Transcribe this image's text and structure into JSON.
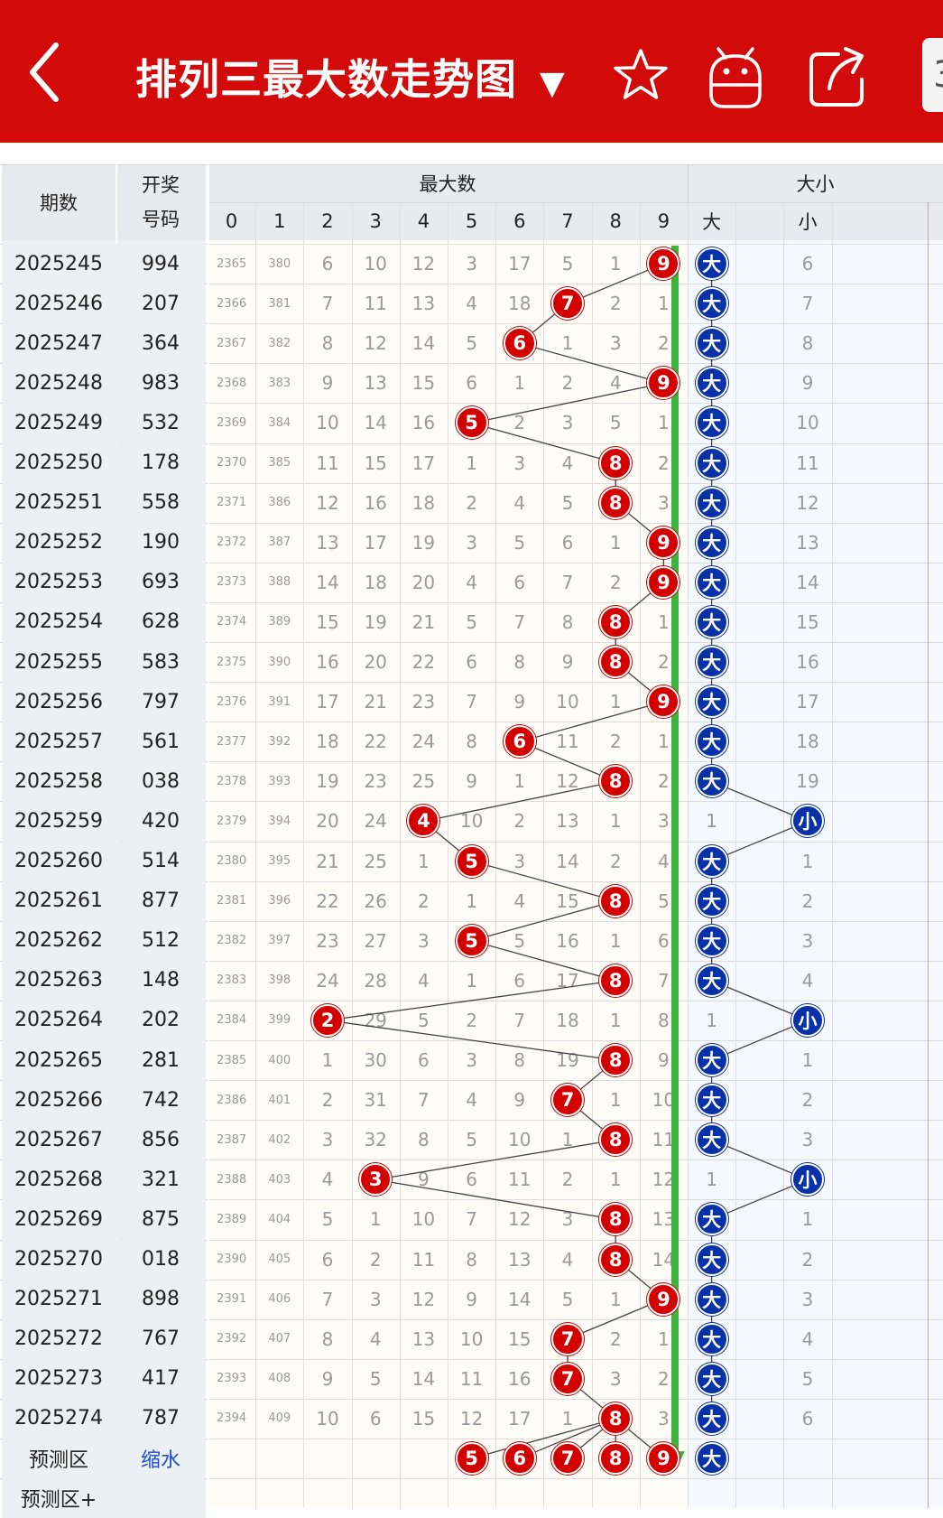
{
  "header": {
    "title": "排列三最大数走势图",
    "menu_caret": "▼",
    "tab_stub_text": "3"
  },
  "table": {
    "headers": {
      "issue": "期数",
      "code_line1": "开奖",
      "code_line2": "号码",
      "max_group": "最大数",
      "size_group": "大小",
      "digits": [
        "0",
        "1",
        "2",
        "3",
        "4",
        "5",
        "6",
        "7",
        "8",
        "9"
      ],
      "size_big": "大",
      "size_small": "小"
    },
    "rows": [
      {
        "issue": "2025245",
        "code": "994",
        "max": 9,
        "miss": [
          "2365",
          "380",
          "6",
          "10",
          "12",
          "3",
          "17",
          "5",
          "1",
          "9"
        ],
        "size": "大",
        "other": "6"
      },
      {
        "issue": "2025246",
        "code": "207",
        "max": 7,
        "miss": [
          "2366",
          "381",
          "7",
          "11",
          "13",
          "4",
          "18",
          "7",
          "2",
          "1"
        ],
        "size": "大",
        "other": "7"
      },
      {
        "issue": "2025247",
        "code": "364",
        "max": 6,
        "miss": [
          "2367",
          "382",
          "8",
          "12",
          "14",
          "5",
          "6",
          "1",
          "3",
          "2"
        ],
        "size": "大",
        "other": "8"
      },
      {
        "issue": "2025248",
        "code": "983",
        "max": 9,
        "miss": [
          "2368",
          "383",
          "9",
          "13",
          "15",
          "6",
          "1",
          "2",
          "4",
          "9"
        ],
        "size": "大",
        "other": "9"
      },
      {
        "issue": "2025249",
        "code": "532",
        "max": 5,
        "miss": [
          "2369",
          "384",
          "10",
          "14",
          "16",
          "5",
          "2",
          "3",
          "5",
          "1"
        ],
        "size": "大",
        "other": "10"
      },
      {
        "issue": "2025250",
        "code": "178",
        "max": 8,
        "miss": [
          "2370",
          "385",
          "11",
          "15",
          "17",
          "1",
          "3",
          "4",
          "8",
          "2"
        ],
        "size": "大",
        "other": "11"
      },
      {
        "issue": "2025251",
        "code": "558",
        "max": 8,
        "miss": [
          "2371",
          "386",
          "12",
          "16",
          "18",
          "2",
          "4",
          "5",
          "8",
          "3"
        ],
        "size": "大",
        "other": "12"
      },
      {
        "issue": "2025252",
        "code": "190",
        "max": 9,
        "miss": [
          "2372",
          "387",
          "13",
          "17",
          "19",
          "3",
          "5",
          "6",
          "1",
          "9"
        ],
        "size": "大",
        "other": "13"
      },
      {
        "issue": "2025253",
        "code": "693",
        "max": 9,
        "miss": [
          "2373",
          "388",
          "14",
          "18",
          "20",
          "4",
          "6",
          "7",
          "2",
          "9"
        ],
        "size": "大",
        "other": "14"
      },
      {
        "issue": "2025254",
        "code": "628",
        "max": 8,
        "miss": [
          "2374",
          "389",
          "15",
          "19",
          "21",
          "5",
          "7",
          "8",
          "8",
          "1"
        ],
        "size": "大",
        "other": "15"
      },
      {
        "issue": "2025255",
        "code": "583",
        "max": 8,
        "miss": [
          "2375",
          "390",
          "16",
          "20",
          "22",
          "6",
          "8",
          "9",
          "8",
          "2"
        ],
        "size": "大",
        "other": "16"
      },
      {
        "issue": "2025256",
        "code": "797",
        "max": 9,
        "miss": [
          "2376",
          "391",
          "17",
          "21",
          "23",
          "7",
          "9",
          "10",
          "1",
          "9"
        ],
        "size": "大",
        "other": "17"
      },
      {
        "issue": "2025257",
        "code": "561",
        "max": 6,
        "miss": [
          "2377",
          "392",
          "18",
          "22",
          "24",
          "8",
          "6",
          "11",
          "2",
          "1"
        ],
        "size": "大",
        "other": "18"
      },
      {
        "issue": "2025258",
        "code": "038",
        "max": 8,
        "miss": [
          "2378",
          "393",
          "19",
          "23",
          "25",
          "9",
          "1",
          "12",
          "8",
          "2"
        ],
        "size": "大",
        "other": "19"
      },
      {
        "issue": "2025259",
        "code": "420",
        "max": 4,
        "miss": [
          "2379",
          "394",
          "20",
          "24",
          "4",
          "10",
          "2",
          "13",
          "1",
          "3"
        ],
        "size": "小",
        "other": "1"
      },
      {
        "issue": "2025260",
        "code": "514",
        "max": 5,
        "miss": [
          "2380",
          "395",
          "21",
          "25",
          "1",
          "5",
          "3",
          "14",
          "2",
          "4"
        ],
        "size": "大",
        "other": "1"
      },
      {
        "issue": "2025261",
        "code": "877",
        "max": 8,
        "miss": [
          "2381",
          "396",
          "22",
          "26",
          "2",
          "1",
          "4",
          "15",
          "8",
          "5"
        ],
        "size": "大",
        "other": "2"
      },
      {
        "issue": "2025262",
        "code": "512",
        "max": 5,
        "miss": [
          "2382",
          "397",
          "23",
          "27",
          "3",
          "5",
          "5",
          "16",
          "1",
          "6"
        ],
        "size": "大",
        "other": "3"
      },
      {
        "issue": "2025263",
        "code": "148",
        "max": 8,
        "miss": [
          "2383",
          "398",
          "24",
          "28",
          "4",
          "1",
          "6",
          "17",
          "8",
          "7"
        ],
        "size": "大",
        "other": "4"
      },
      {
        "issue": "2025264",
        "code": "202",
        "max": 2,
        "miss": [
          "2384",
          "399",
          "2",
          "29",
          "5",
          "2",
          "7",
          "18",
          "1",
          "8"
        ],
        "size": "小",
        "other": "1"
      },
      {
        "issue": "2025265",
        "code": "281",
        "max": 8,
        "miss": [
          "2385",
          "400",
          "1",
          "30",
          "6",
          "3",
          "8",
          "19",
          "8",
          "9"
        ],
        "size": "大",
        "other": "1"
      },
      {
        "issue": "2025266",
        "code": "742",
        "max": 7,
        "miss": [
          "2386",
          "401",
          "2",
          "31",
          "7",
          "4",
          "9",
          "7",
          "1",
          "10"
        ],
        "size": "大",
        "other": "2"
      },
      {
        "issue": "2025267",
        "code": "856",
        "max": 8,
        "miss": [
          "2387",
          "402",
          "3",
          "32",
          "8",
          "5",
          "10",
          "1",
          "8",
          "11"
        ],
        "size": "大",
        "other": "3"
      },
      {
        "issue": "2025268",
        "code": "321",
        "max": 3,
        "miss": [
          "2388",
          "403",
          "4",
          "3",
          "9",
          "6",
          "11",
          "2",
          "1",
          "12"
        ],
        "size": "小",
        "other": "1"
      },
      {
        "issue": "2025269",
        "code": "875",
        "max": 8,
        "miss": [
          "2389",
          "404",
          "5",
          "1",
          "10",
          "7",
          "12",
          "3",
          "8",
          "13"
        ],
        "size": "大",
        "other": "1"
      },
      {
        "issue": "2025270",
        "code": "018",
        "max": 8,
        "miss": [
          "2390",
          "405",
          "6",
          "2",
          "11",
          "8",
          "13",
          "4",
          "8",
          "14"
        ],
        "size": "大",
        "other": "2"
      },
      {
        "issue": "2025271",
        "code": "898",
        "max": 9,
        "miss": [
          "2391",
          "406",
          "7",
          "3",
          "12",
          "9",
          "14",
          "5",
          "1",
          "9"
        ],
        "size": "大",
        "other": "3"
      },
      {
        "issue": "2025272",
        "code": "767",
        "max": 7,
        "miss": [
          "2392",
          "407",
          "8",
          "4",
          "13",
          "10",
          "15",
          "7",
          "2",
          "1"
        ],
        "size": "大",
        "other": "4"
      },
      {
        "issue": "2025273",
        "code": "417",
        "max": 7,
        "miss": [
          "2393",
          "408",
          "9",
          "5",
          "14",
          "11",
          "16",
          "7",
          "3",
          "2"
        ],
        "size": "大",
        "other": "5"
      },
      {
        "issue": "2025274",
        "code": "787",
        "max": 8,
        "miss": [
          "2394",
          "409",
          "10",
          "6",
          "15",
          "12",
          "17",
          "1",
          "8",
          "3"
        ],
        "size": "大",
        "other": "6"
      }
    ],
    "prediction": {
      "label": "预测区",
      "action": "缩水",
      "digits": [
        "5",
        "6",
        "7",
        "8",
        "9"
      ],
      "size": "大"
    },
    "prediction_plus": {
      "label": "预测区+"
    }
  },
  "colors": {
    "brand_red": "#d20a0a",
    "ball_red": "#d40000",
    "ball_blue": "#0a32a8",
    "trend_arrow": "#3cb43c"
  },
  "icons": [
    "back-arrow-icon",
    "dropdown-caret-icon",
    "star-icon",
    "android-robot-icon",
    "share-icon"
  ]
}
